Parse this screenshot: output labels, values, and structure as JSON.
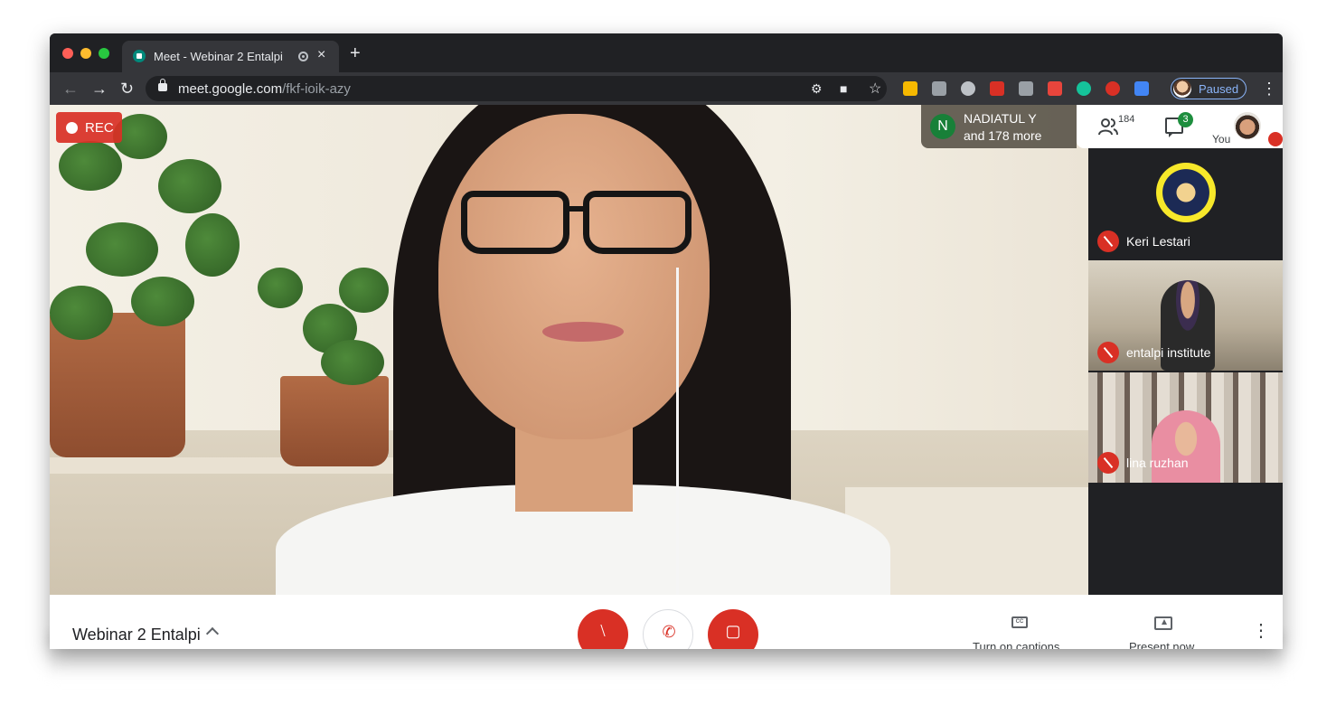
{
  "browser": {
    "tab_title": "Meet - Webinar 2 Entalpi",
    "tab_close": "×",
    "new_tab": "+",
    "url_host": "meet.google.com",
    "url_path": "/fkf-ioik-azy",
    "profile_status": "Paused",
    "icons": {
      "back": "arrow-left-icon",
      "forward": "arrow-right-icon",
      "reload": "reload-icon",
      "lock": "lock-icon",
      "star": "star-icon",
      "camera": "camera-icon",
      "menu": "kebab-menu-icon"
    }
  },
  "meet": {
    "rec_label": "REC",
    "active_speaker": {
      "initial": "N",
      "name": "NADIATUL Y",
      "more": "and 178 more",
      "color": "#188038"
    },
    "people_count": "184",
    "chat_count": "3",
    "self_label": "You",
    "participants": [
      {
        "name": "Keri Lestari",
        "muted": true
      },
      {
        "name": "entalpi institute",
        "muted": true
      },
      {
        "name": "lina ruzhan",
        "muted": true
      }
    ],
    "meeting_title": "Webinar 2 Entalpi",
    "captions_label": "Turn on captions",
    "captions_icon_text": "CC",
    "present_label": "Present now",
    "colors": {
      "danger": "#d93025",
      "badge": "#1e8e3e",
      "accent": "#8ab4f8"
    }
  }
}
